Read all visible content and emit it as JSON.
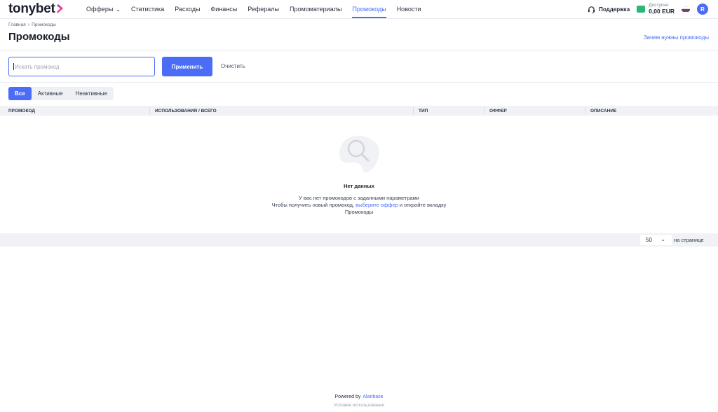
{
  "header": {
    "logo_text": "tonybet",
    "nav": [
      {
        "label": "Офферы",
        "dropdown": true,
        "active": false
      },
      {
        "label": "Статистика",
        "active": false
      },
      {
        "label": "Расходы",
        "active": false
      },
      {
        "label": "Финансы",
        "active": false
      },
      {
        "label": "Рефералы",
        "active": false
      },
      {
        "label": "Промоматериалы",
        "active": false
      },
      {
        "label": "Промокоды",
        "active": true
      },
      {
        "label": "Новости",
        "active": false
      }
    ],
    "support_label": "Поддержка",
    "balance_label": "Доступно",
    "balance_value": "0,00 EUR",
    "avatar_letter": "R",
    "accent_color": "#4a6cf7"
  },
  "breadcrumb": {
    "home": "Главная",
    "current": "Промокоды"
  },
  "page": {
    "title": "Промокоды",
    "why_link": "Зачем нужны промокоды"
  },
  "filters": {
    "search_placeholder": "Искать промокод",
    "search_value": "",
    "apply_label": "Применить",
    "clear_label": "Очистить",
    "tabs": [
      {
        "label": "Все",
        "active": true
      },
      {
        "label": "Активные",
        "active": false
      },
      {
        "label": "Неактивные",
        "active": false
      }
    ]
  },
  "table": {
    "columns": [
      "ПРОМОКОД",
      "ИСПОЛЬЗОВАНИЯ / ВСЕГО",
      "ТИП",
      "ОФФЕР",
      "ОПИСАНИЕ"
    ],
    "rows": []
  },
  "empty_state": {
    "icon": "search-magnifier-icon",
    "title": "Нет данных",
    "line1": "У вас нет промокодов с заданными параметрами",
    "line2_before": "Чтобы получить новый промокод,",
    "line2_link": "выберите оффер",
    "line2_after": "и откройте вкладку",
    "line3": "Промокоды"
  },
  "pagination": {
    "per_page_value": "50",
    "per_page_label": "на странице"
  },
  "footer": {
    "powered_by": "Powered by",
    "brand": "Alanbase",
    "terms": "Условия использования"
  }
}
